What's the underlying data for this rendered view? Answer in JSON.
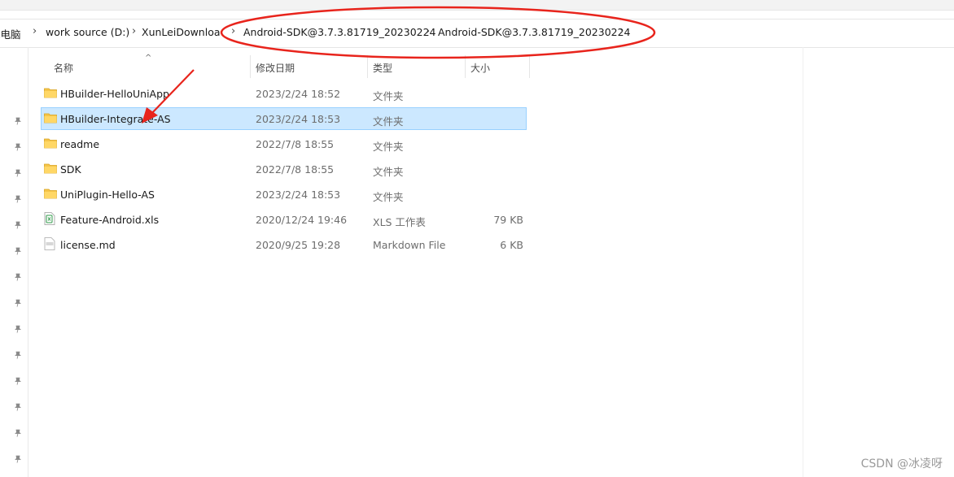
{
  "address_bar": {
    "crumbs": [
      "此电脑",
      "work source (D:)",
      "XunLeiDownload",
      "Android-SDK@3.7.3.81719_20230224",
      "Android-SDK@3.7.3.81719_20230224"
    ],
    "separator": "›"
  },
  "columns": {
    "name": "名称",
    "date": "修改日期",
    "type": "类型",
    "size": "大小"
  },
  "files": [
    {
      "name": "HBuilder-HelloUniApp",
      "date": "2023/2/24 18:52",
      "type": "文件夹",
      "size": "",
      "icon": "folder-icon"
    },
    {
      "name": "HBuilder-Integrate-AS",
      "date": "2023/2/24 18:53",
      "type": "文件夹",
      "size": "",
      "icon": "folder-icon",
      "selected": true
    },
    {
      "name": "readme",
      "date": "2022/7/8 18:55",
      "type": "文件夹",
      "size": "",
      "icon": "folder-icon"
    },
    {
      "name": "SDK",
      "date": "2022/7/8 18:55",
      "type": "文件夹",
      "size": "",
      "icon": "folder-icon"
    },
    {
      "name": "UniPlugin-Hello-AS",
      "date": "2023/2/24 18:53",
      "type": "文件夹",
      "size": "",
      "icon": "folder-icon"
    },
    {
      "name": "Feature-Android.xls",
      "date": "2020/12/24 19:46",
      "type": "XLS 工作表",
      "size": "79 KB",
      "icon": "xls-file-icon"
    },
    {
      "name": "license.md",
      "date": "2020/9/25 19:28",
      "type": "Markdown File",
      "size": "6 KB",
      "icon": "markdown-file-icon"
    }
  ],
  "colors": {
    "selection_bg": "#cce8ff",
    "selection_border": "#99d1ff",
    "annotation": "#e8241c",
    "folder": "#f4c542"
  },
  "watermark": "CSDN @冰凌呀"
}
